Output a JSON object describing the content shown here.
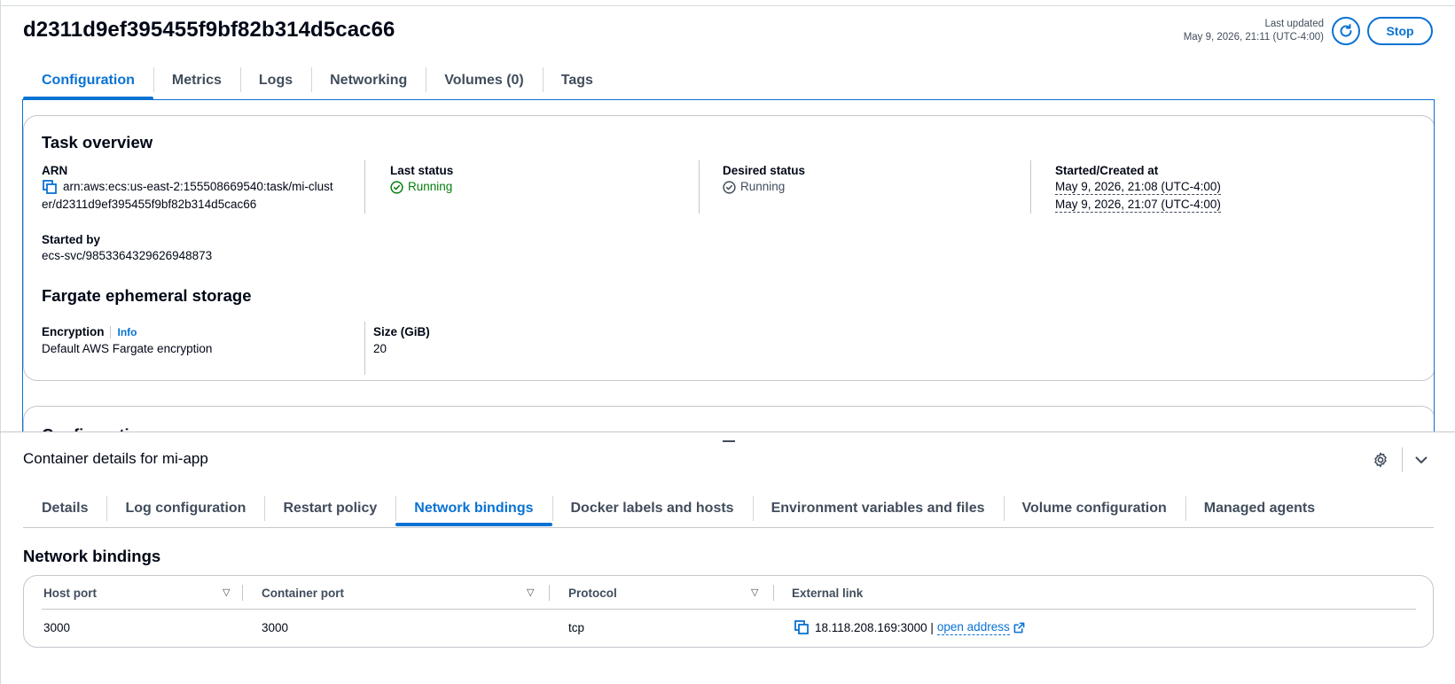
{
  "header": {
    "task_id": "d2311d9ef395455f9bf82b314d5cac66",
    "last_updated_label": "Last updated",
    "last_updated_value": "May 9, 2026, 21:11 (UTC-4:00)",
    "refresh_icon": "refresh-icon",
    "stop_label": "Stop"
  },
  "top_tabs": [
    {
      "label": "Configuration",
      "active": true
    },
    {
      "label": "Metrics",
      "active": false
    },
    {
      "label": "Logs",
      "active": false
    },
    {
      "label": "Networking",
      "active": false
    },
    {
      "label": "Volumes (0)",
      "active": false
    },
    {
      "label": "Tags",
      "active": false
    }
  ],
  "task_overview": {
    "title": "Task overview",
    "arn_label": "ARN",
    "arn_line1": "arn:aws:ecs:us-east-2:155508669540:task/mi-clust",
    "arn_line2": "er/d2311d9ef395455f9bf82b314d5cac66",
    "last_status_label": "Last status",
    "last_status_value": "Running",
    "desired_status_label": "Desired status",
    "desired_status_value": "Running",
    "started_created_label": "Started/Created at",
    "started_at": "May 9, 2026, 21:08 (UTC-4:00)",
    "created_at": "May 9, 2026, 21:07 (UTC-4:00)",
    "started_by_label": "Started by",
    "started_by_value": "ecs-svc/9853364329626948873"
  },
  "ephemeral_storage": {
    "title": "Fargate ephemeral storage",
    "encryption_label": "Encryption",
    "info_label": "Info",
    "encryption_value": "Default AWS Fargate encryption",
    "size_label": "Size (GiB)",
    "size_value": "20"
  },
  "configuration_section": {
    "title": "Configuration"
  },
  "container_details": {
    "title": "Container details for mi-app",
    "tabs": [
      {
        "label": "Details",
        "active": false
      },
      {
        "label": "Log configuration",
        "active": false
      },
      {
        "label": "Restart policy",
        "active": false
      },
      {
        "label": "Network bindings",
        "active": true
      },
      {
        "label": "Docker labels and hosts",
        "active": false
      },
      {
        "label": "Environment variables and files",
        "active": false
      },
      {
        "label": "Volume configuration",
        "active": false
      },
      {
        "label": "Managed agents",
        "active": false
      }
    ]
  },
  "network_bindings": {
    "title": "Network bindings",
    "columns": [
      "Host port",
      "Container port",
      "Protocol",
      "External link"
    ],
    "rows": [
      {
        "host_port": "3000",
        "container_port": "3000",
        "protocol": "tcp",
        "external_address": "18.118.208.169:3000 |",
        "link_label": "open address"
      }
    ]
  },
  "colors": {
    "accent": "#0972d3",
    "running": "#037f0c",
    "text": "#000716",
    "muted": "#414d5c",
    "border": "#c6c6cd"
  }
}
